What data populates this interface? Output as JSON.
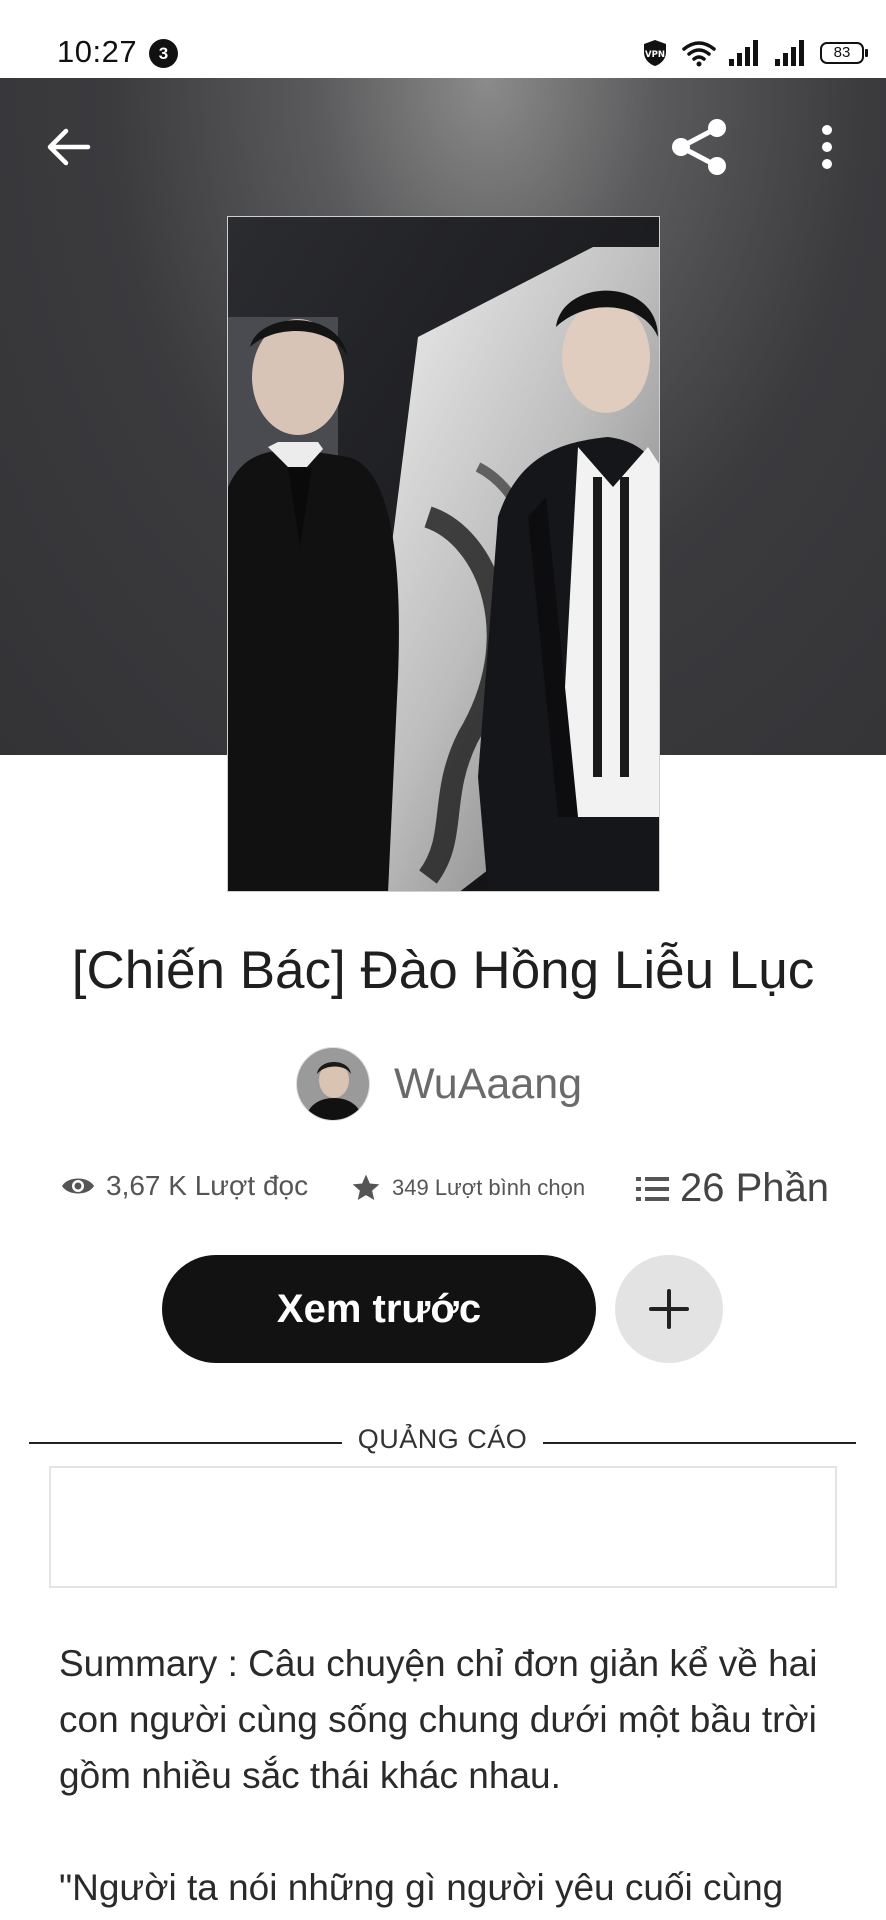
{
  "status_bar": {
    "time": "10:27",
    "notification_count": "3",
    "vpn_label": "VPN",
    "battery": "83"
  },
  "header": {
    "back_icon": "arrow-left-icon",
    "share_icon": "share-icon",
    "more_icon": "more-vertical-icon"
  },
  "story": {
    "title": "[Chiến Bác] Đào Hồng Liễu Lục",
    "author": "WuAaang",
    "reads": "3,67 K Lượt đọc",
    "votes": "349 Lượt bình chọn",
    "parts": "26 Phần"
  },
  "actions": {
    "preview_label": "Xem trước",
    "add_icon": "plus-icon"
  },
  "ad": {
    "label": "QUẢNG CÁO"
  },
  "summary": {
    "paragraph1": "Summary : Câu chuyện chỉ đơn giản kể về hai con người cùng sống chung dưới một bầu trời gồm nhiều sắc thái khác nhau.",
    "paragraph2": "\"Người ta nói những gì người yêu cuối cùng"
  },
  "colors": {
    "header_bg": "#3b3b3e",
    "primary_button": "#121212",
    "secondary_button": "#e3e3e3"
  }
}
